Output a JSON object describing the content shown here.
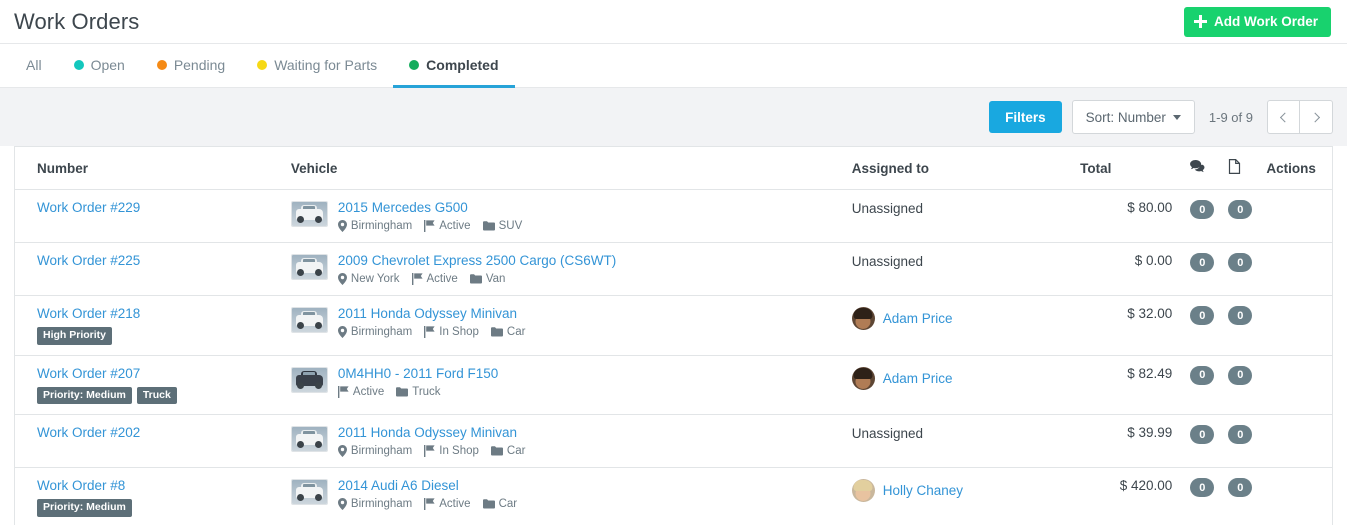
{
  "header": {
    "title": "Work Orders",
    "add_button": {
      "label": "Add Work Order",
      "icon": "plus-icon",
      "color": "#18d26e"
    }
  },
  "tabs": [
    {
      "label": "All",
      "dot": null,
      "active": false
    },
    {
      "label": "Open",
      "dot": "#13c7bd",
      "active": false
    },
    {
      "label": "Pending",
      "dot": "#f58a15",
      "active": false
    },
    {
      "label": "Waiting for Parts",
      "dot": "#f6d915",
      "active": false
    },
    {
      "label": "Completed",
      "dot": "#13ac5c",
      "active": true
    }
  ],
  "toolbar": {
    "filters_label": "Filters",
    "filters_color": "#19a8e0",
    "sort_label": "Sort: Number",
    "page_count": "1-9 of 9",
    "prev_icon": "chevron-left-icon",
    "next_icon": "chevron-right-icon"
  },
  "table": {
    "columns": {
      "number": "Number",
      "vehicle": "Vehicle",
      "assigned": "Assigned to",
      "total": "Total",
      "comments_icon": "comments-icon",
      "documents_icon": "document-icon",
      "actions": "Actions"
    },
    "rows": [
      {
        "number": "Work Order #229",
        "badges": [],
        "vehicle": "2015 Mercedes G500",
        "location": "Birmingham",
        "status": "Active",
        "type": "SUV",
        "assigned": "Unassigned",
        "avatar": null,
        "total": "$ 80.00",
        "comments": "0",
        "documents": "0"
      },
      {
        "number": "Work Order #225",
        "badges": [],
        "vehicle": "2009 Chevrolet Express 2500 Cargo (CS6WT)",
        "location": "New York",
        "status": "Active",
        "type": "Van",
        "assigned": "Unassigned",
        "avatar": null,
        "total": "$ 0.00",
        "comments": "0",
        "documents": "0"
      },
      {
        "number": "Work Order #218",
        "badges": [
          "High Priority"
        ],
        "vehicle": "2011 Honda Odyssey Minivan",
        "location": "Birmingham",
        "status": "In Shop",
        "type": "Car",
        "assigned": "Adam Price",
        "avatar": "a-adam",
        "total": "$ 32.00",
        "comments": "0",
        "documents": "0"
      },
      {
        "number": "Work Order #207",
        "badges": [
          "Priority: Medium",
          "Truck"
        ],
        "vehicle": "0M4HH0 - 2011 Ford F150",
        "location": null,
        "status": "Active",
        "type": "Truck",
        "assigned": "Adam Price",
        "avatar": "a-adam",
        "total": "$ 82.49",
        "comments": "0",
        "documents": "0"
      },
      {
        "number": "Work Order #202",
        "badges": [],
        "vehicle": "2011 Honda Odyssey Minivan",
        "location": "Birmingham",
        "status": "In Shop",
        "type": "Car",
        "assigned": "Unassigned",
        "avatar": null,
        "total": "$ 39.99",
        "comments": "0",
        "documents": "0"
      },
      {
        "number": "Work Order #8",
        "badges": [
          "Priority: Medium"
        ],
        "vehicle": "2014 Audi A6 Diesel",
        "location": "Birmingham",
        "status": "Active",
        "type": "Car",
        "assigned": "Holly Chaney",
        "avatar": "a-holly",
        "total": "$ 420.00",
        "comments": "0",
        "documents": "0"
      }
    ]
  }
}
